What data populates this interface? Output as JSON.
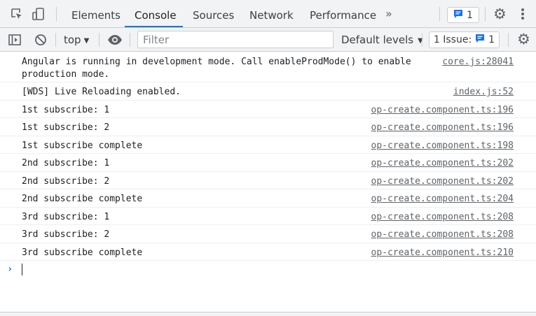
{
  "tabbar": {
    "tabs": [
      {
        "label": "Elements"
      },
      {
        "label": "Console"
      },
      {
        "label": "Sources"
      },
      {
        "label": "Network"
      },
      {
        "label": "Performance"
      }
    ],
    "more_icon": "chevron-double-right-icon",
    "messages_badge_count": "1",
    "accent_color": "#1a73e8"
  },
  "toolbar": {
    "context": "top",
    "filter_placeholder": "Filter",
    "filter_value": "",
    "levels_label": "Default levels",
    "issues_label": "1 Issue:",
    "issues_count": "1"
  },
  "console": {
    "messages": [
      {
        "text": "Angular is running in development mode. Call enableProdMode() to enable production mode.",
        "source": "core.js:28041"
      },
      {
        "text": "[WDS] Live Reloading enabled.",
        "source": "index.js:52"
      },
      {
        "text": "1st subscribe: 1",
        "source": "op-create.component.ts:196"
      },
      {
        "text": "1st subscribe: 2",
        "source": "op-create.component.ts:196"
      },
      {
        "text": "1st subscribe complete",
        "source": "op-create.component.ts:198"
      },
      {
        "text": "2nd subscribe: 1",
        "source": "op-create.component.ts:202"
      },
      {
        "text": "2nd subscribe: 2",
        "source": "op-create.component.ts:202"
      },
      {
        "text": "2nd subscribe complete",
        "source": "op-create.component.ts:204"
      },
      {
        "text": "3rd subscribe: 1",
        "source": "op-create.component.ts:208"
      },
      {
        "text": "3rd subscribe: 2",
        "source": "op-create.component.ts:208"
      },
      {
        "text": "3rd subscribe complete",
        "source": "op-create.component.ts:210"
      }
    ],
    "prompt_symbol": "›"
  }
}
